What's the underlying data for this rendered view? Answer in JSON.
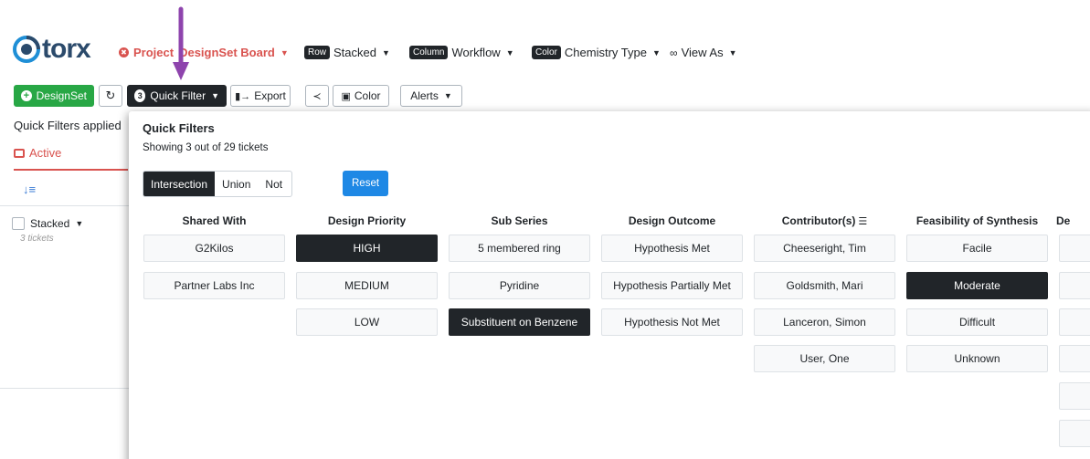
{
  "header": {
    "logo_text": "torx",
    "project": "Project",
    "project_board": "DesignSet Board",
    "row_tag": "Row",
    "row_value": "Stacked",
    "column_tag": "Column",
    "column_value": "Workflow",
    "color_tag": "Color",
    "color_value": "Chemistry Type",
    "view_as": "View As"
  },
  "toolbar": {
    "designset": "DesignSet",
    "refresh_icon": "refresh-icon",
    "quick_filter_count": "3",
    "quick_filter": "Quick Filter",
    "export": "Export",
    "share_icon": "share-icon",
    "color": "Color",
    "alerts": "Alerts"
  },
  "left": {
    "quick_filters_applied": "Quick Filters applied",
    "active": "Active",
    "stacked": "Stacked",
    "tickets": "3 tickets"
  },
  "panel": {
    "title": "Quick Filters",
    "showing": "Showing 3 out of 29 tickets",
    "modes": [
      "Intersection",
      "Union",
      "Not"
    ],
    "selected_mode": "Intersection",
    "reset": "Reset",
    "columns": [
      {
        "header": "Shared With",
        "options": [
          "G2Kilos",
          "Partner Labs Inc"
        ],
        "selected": []
      },
      {
        "header": "Design Priority",
        "options": [
          "HIGH",
          "MEDIUM",
          "LOW"
        ],
        "selected": [
          "HIGH"
        ]
      },
      {
        "header": "Sub Series",
        "options": [
          "5 membered ring",
          "Pyridine",
          "Substituent on Benzene"
        ],
        "selected": [
          "Substituent on Benzene"
        ]
      },
      {
        "header": "Design Outcome",
        "options": [
          "Hypothesis Met",
          "Hypothesis Partially Met",
          "Hypothesis Not Met"
        ],
        "selected": []
      },
      {
        "header": "Contributor(s)",
        "options": [
          "Cheeseright, Tim",
          "Goldsmith, Mari",
          "Lanceron, Simon",
          "User, One"
        ],
        "selected": []
      },
      {
        "header": "Feasibility of Synthesis",
        "options": [
          "Facile",
          "Moderate",
          "Difficult",
          "Unknown"
        ],
        "selected": [
          "Moderate"
        ]
      },
      {
        "header": "De",
        "options": [
          "",
          "",
          "",
          "",
          "",
          ""
        ],
        "selected": []
      }
    ]
  },
  "colors": {
    "accent_dark": "#212529",
    "brand_green": "#28a745",
    "project_red": "#d9534f",
    "reset_blue": "#1e88e5",
    "annotation_arrow": "#8e44ad"
  }
}
